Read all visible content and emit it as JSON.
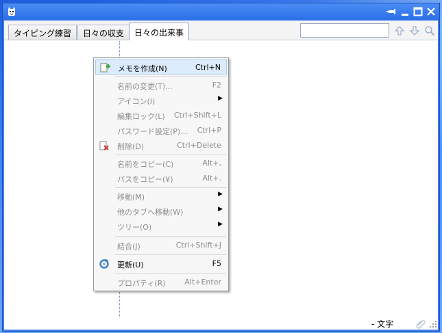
{
  "window": {
    "tabs": [
      {
        "label": "タイピング練習",
        "active": false
      },
      {
        "label": "日々の収支",
        "active": false
      },
      {
        "label": "日々の出来事",
        "active": true
      }
    ],
    "search": {
      "value": ""
    },
    "titlebar_buttons": [
      "pin",
      "minimize",
      "maximize",
      "close"
    ]
  },
  "statusbar": {
    "text": "- 文字"
  },
  "context_menu": {
    "items": [
      {
        "label": "メモを作成(N)",
        "shortcut": "Ctrl+N",
        "enabled": true,
        "highlighted": true,
        "icon": "new-memo-icon"
      },
      {
        "label": "名前の変更(T)...",
        "shortcut": "F2",
        "enabled": false
      },
      {
        "label": "アイコン(I)",
        "shortcut": "",
        "enabled": false,
        "submenu": true
      },
      {
        "label": "編集ロック(L)",
        "shortcut": "Ctrl+Shift+L",
        "enabled": false
      },
      {
        "label": "パスワード設定(P)...",
        "shortcut": "Ctrl+P",
        "enabled": false
      },
      {
        "label": "削除(D)",
        "shortcut": "Ctrl+Delete",
        "enabled": false,
        "icon": "delete-icon"
      },
      {
        "label": "名前をコピー(C)",
        "shortcut": "Alt+,",
        "enabled": false
      },
      {
        "label": "パスをコピー(¥)",
        "shortcut": "Alt+.",
        "enabled": false
      },
      {
        "label": "移動(M)",
        "shortcut": "",
        "enabled": false,
        "submenu": true
      },
      {
        "label": "他のタブへ移動(W)",
        "shortcut": "",
        "enabled": false,
        "submenu": true
      },
      {
        "label": "ツリー(O)",
        "shortcut": "",
        "enabled": false,
        "submenu": true
      },
      {
        "label": "結合(J)",
        "shortcut": "Ctrl+Shift+J",
        "enabled": false
      },
      {
        "label": "更新(U)",
        "shortcut": "F5",
        "enabled": true,
        "icon": "refresh-icon"
      },
      {
        "label": "プロパティ(R)",
        "shortcut": "Alt+Enter",
        "enabled": false
      }
    ]
  },
  "colors": {
    "titlebar": "#2a6ee8",
    "menu_highlight": "#dcebfb",
    "disabled_text": "#8c8c8c"
  }
}
